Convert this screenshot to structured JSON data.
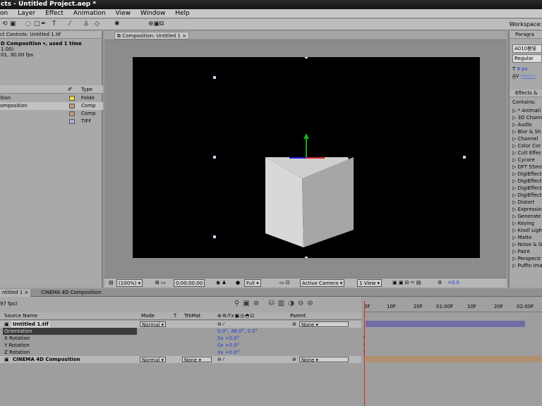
{
  "titlebar": {
    "title": "cts - Untitled Project.aep *"
  },
  "menu": [
    "on",
    "Layer",
    "Effect",
    "Animation",
    "View",
    "Window",
    "Help"
  ],
  "toolbar": {
    "workspace_label": "Workspace:"
  },
  "effect_controls": {
    "tab": "ct Controls: Untitled 1.tif",
    "line1": "D Composition ▾, used 1 time",
    "line2": "1.00)",
    "line3": "01, 30.00 fps"
  },
  "project": {
    "col_type": "Type",
    "rows": [
      {
        "name": "ition",
        "type": "Folde",
        "color": "#e8d84a"
      },
      {
        "name": "omposition",
        "type": "Comp",
        "color": "#b59f7a"
      },
      {
        "name": "",
        "type": "Comp",
        "color": "#b59f7a"
      },
      {
        "name": "",
        "type": "TIFF",
        "color": "#b0b0d8"
      }
    ]
  },
  "composition": {
    "tab": "Composition: Untitled 1",
    "zoom": "(100%)",
    "timecode": "0;00;00;00",
    "resolution": "Full",
    "camera": "Active Camera",
    "view": "1 View",
    "offset": "+0.0"
  },
  "right": {
    "tab_paragraph": "Paragra",
    "font": "A010봄빛",
    "style": "Regular",
    "size": "9 px",
    "metrics": "Metric",
    "tab_effects": "Effects &",
    "contains": "Contains:",
    "effects": [
      "* Animati",
      "3D Chann",
      "Audio",
      "Blur & Sh",
      "Channel",
      "Color Cor",
      "Cult Effec",
      "Cycore",
      "DFT 55mr",
      "DigiEffect",
      "DigiEffect",
      "DigiEffect",
      "DigiEffect",
      "Distort",
      "Expressio",
      "Generate",
      "Keying",
      "Knoll Ligh",
      "Matte",
      "Noise & G",
      "Paint",
      "Perspectr",
      "Puffin Ima"
    ]
  },
  "timeline": {
    "tab1": "ntitled 1",
    "tab2": "CINEMA 4D Composition",
    "fps": "97 fps)",
    "cols": {
      "source": "Source Name",
      "mode": "Mode",
      "t": "T",
      "trkmat": "TrkMat",
      "parent": "Parent"
    },
    "layer1": {
      "name": "Untitled 1.tif",
      "mode": "Normal",
      "parent": "None"
    },
    "props": [
      {
        "name": "Orientation",
        "value": "0.0°, 48.0°, 0.0°"
      },
      {
        "name": "X Rotation",
        "value": "0x +0.0°"
      },
      {
        "name": "Y Rotation",
        "value": "0x +0.0°"
      },
      {
        "name": "Z Rotation",
        "value": "0x +0.0°"
      }
    ],
    "layer2": {
      "name": "CINEMA 4D Composition",
      "mode": "Normal",
      "trkmat": "None",
      "parent": "None"
    },
    "ruler": [
      "0F",
      "10F",
      "20F",
      "01:00F",
      "10F",
      "20F",
      "02:00F"
    ]
  }
}
